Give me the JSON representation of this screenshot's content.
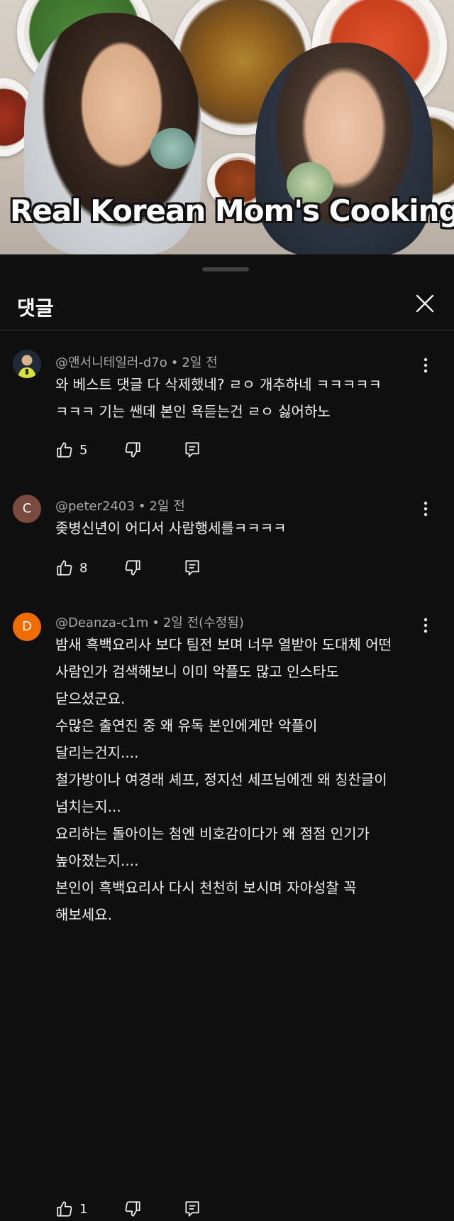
{
  "video": {
    "title_overlay": "Real Korean Mom's Cooking"
  },
  "sheet": {
    "title": "댓글"
  },
  "comments": [
    {
      "author": "@앤서니테일러-d7o",
      "age": "2일 전",
      "avatar": {
        "initial": "",
        "color": "#1f2a36"
      },
      "lines": [
        "와 베스트 댓글 다 삭제했네? ㄹㅇ 개추하네 ㅋㅋㅋㅋㅋ",
        "ㅋㅋㅋ 기는 쌘데 본인 욕듣는건 ㄹㅇ 싫어하노"
      ],
      "likes": "5"
    },
    {
      "author": "@peter2403",
      "age": "2일 전",
      "avatar": {
        "initial": "C",
        "color": "#7a4a3e"
      },
      "lines": [
        "좆병신년이 어디서 사람행세를ㅋㅋㅋㅋ"
      ],
      "likes": "8"
    },
    {
      "author": "@Deanza-c1m",
      "age": "2일 전(수정됨)",
      "avatar": {
        "initial": "D",
        "color": "#ef6c00"
      },
      "lines": [
        "밤새 흑백요리사 보다 팀전 보며 너무 열받아 도대체 어떤",
        "사람인가 검색해보니 이미 악플도 많고 인스타도",
        "닫으셨군요.",
        "수많은 출연진 중 왜 유독 본인에게만 악플이",
        "달리는건지....",
        "철가방이나 여경래 셰프, 정지선 세프님에겐 왜  칭찬글이",
        "넘치는지...",
        "요리하는 돌아이는 첨엔 비호감이다가 왜 점점 인기가",
        "높아졌는지....",
        "본인이 흑백요리사 다시 천천히 보시며 자아성찰 꼭",
        "해보세요."
      ],
      "likes": "1"
    }
  ],
  "icons": {
    "like": "thumbs-up-icon",
    "dislike": "thumbs-down-icon",
    "reply": "reply-icon",
    "more": "more-vert-icon",
    "close": "close-icon"
  }
}
